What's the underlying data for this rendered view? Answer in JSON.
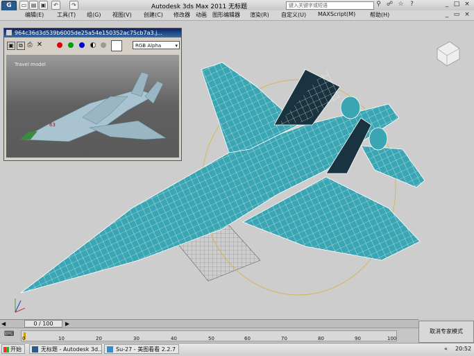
{
  "app": {
    "logo_glyph": "G",
    "title": "Autodesk 3ds Max  2011    无标题",
    "search_placeholder": "键入关键字或短语",
    "quick_access": [
      "new",
      "open",
      "save",
      "undo",
      "redo"
    ],
    "window_controls": [
      "_",
      "□",
      "×"
    ],
    "doc_controls": [
      "_",
      "▭",
      "×"
    ]
  },
  "menu": {
    "items": [
      "编辑(E)",
      "工具(T)",
      "组(G)",
      "视图(V)",
      "创建(C)",
      "修改器",
      "动画",
      "图形编辑器",
      "渲染(R)",
      "自定义(U)",
      "MAXScript(M)",
      "帮助(H)"
    ]
  },
  "image_window": {
    "title": "964c36d3d539b6005de25a54e150352ac75cb7a3.j...",
    "channel_select": "RGB Alpha",
    "colors": {
      "red": "#e00000",
      "green": "#00a000",
      "blue": "#0000d0"
    },
    "caption": "Travel model",
    "marking": "63"
  },
  "timeline": {
    "frame_label": "0 / 100",
    "ticks": [
      "0",
      "10",
      "20",
      "30",
      "40",
      "50",
      "60",
      "70",
      "80",
      "90",
      "100"
    ]
  },
  "expert_mode_button": "取消专家模式",
  "taskbar": {
    "start": "开始",
    "tasks": [
      "无标题 - Autodesk 3d...",
      "Su-27 - 美图看看 2.2.7"
    ],
    "clock": "20:52"
  }
}
